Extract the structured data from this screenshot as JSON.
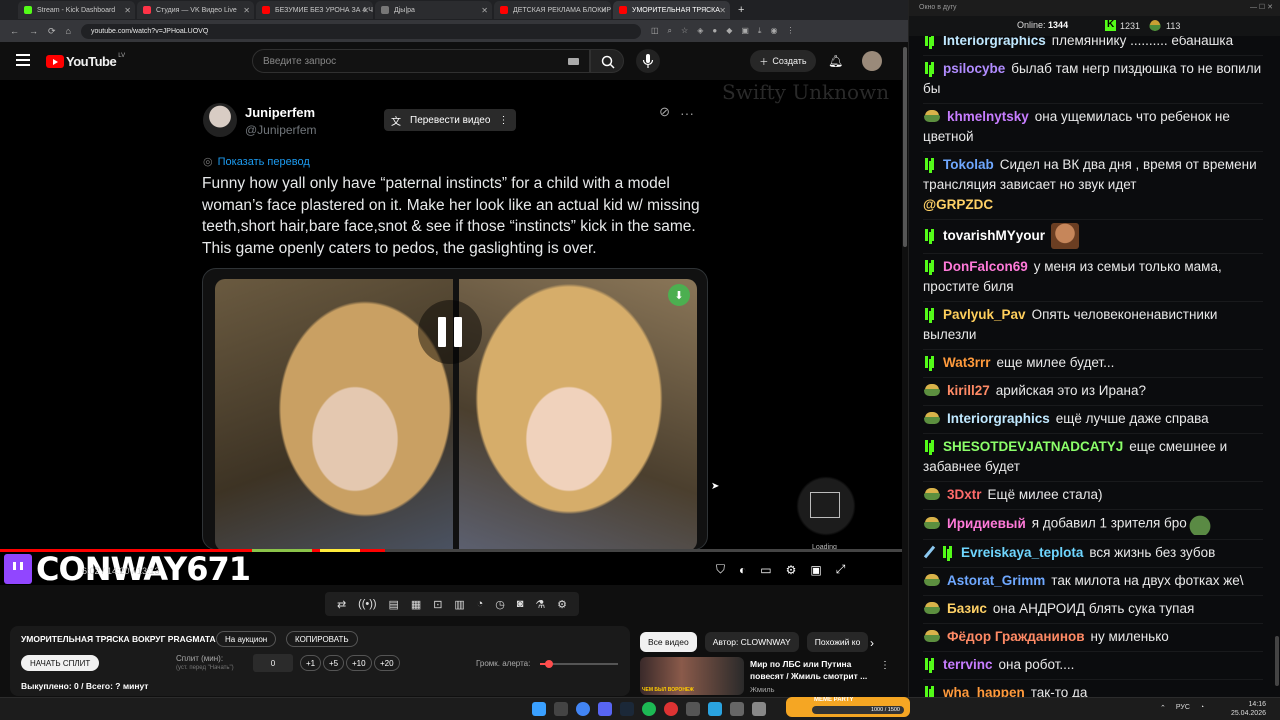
{
  "browser": {
    "tabs": [
      {
        "label": "Stream - Kick Dashboard",
        "color": "#53fc18"
      },
      {
        "label": "Студия — VK Видео Live",
        "color": "#ff3347"
      },
      {
        "label": "БЕЗУМИЕ БЕЗ УРОНА ЗА 4 ЧА",
        "color": "#ff0000"
      },
      {
        "label": "Дjы|ра",
        "color": "#777777"
      },
      {
        "label": "ДЕТСКАЯ РЕКЛАМА БЛОКИРО",
        "color": "#ff0000"
      },
      {
        "label": "УМОРИТЕЛЬНАЯ ТРЯСКА",
        "color": "#ff0000"
      }
    ],
    "url": "youtube.com/watch?v=JPHoaLUOVQ"
  },
  "youtube": {
    "region": "LV",
    "search_placeholder": "Введите запрос",
    "create_label": "Создать"
  },
  "tweet": {
    "name": "Juniperfem",
    "handle": "@Juniperfem",
    "translate_video": "Перевести видео",
    "show_translation": "Показать перевод",
    "text": "Funny how yall only have “paternal instincts” for a child with a model woman’s face plastered on it. Make her look like an actual kid w/ missing teeth,short hair,bare face,snot & see if those “instincts” kick in the same. This game openly caters to pedos, the gaslighting is over."
  },
  "watermark": "Swifty Unknown",
  "player": {
    "streamer": "CONWAY671",
    "time": "6:02 / 14:20 / 13:13",
    "loading": "Loading",
    "progress": 0.424
  },
  "panel": {
    "title": "УМОРИТЕЛЬНАЯ ТРЯСКА ВОКРУГ PRAGMATA",
    "auction": "На аукцион",
    "copy": "КОПИРОВАТЬ",
    "start_split": "НАЧАТЬ СПЛИТ",
    "split_label": "Сплит (мин):",
    "split_hint": "(уст. перед \"Начать\")",
    "split_value": "0",
    "inc": [
      "+1",
      "+5",
      "+10",
      "+20"
    ],
    "alert_volume": "Громк. алерта:",
    "alert_level": 0.12,
    "bought": "Выкуплено: 0 / Всего: ? минут"
  },
  "recs": {
    "chips": [
      "Все видео",
      "Автор: CLOWNWAY",
      "Похожий ко"
    ],
    "video_title": "Мир по ЛБС или Путина повесят / Жмиль смотрит ...",
    "video_author": "Жмиль",
    "thumb_text": "ЧЕМ БЫЛ ВОРОНЕЖ"
  },
  "chat": {
    "window_title": "Окно в дугу",
    "online_label": "Online:",
    "online": "1344",
    "kick_count": "1231",
    "sub_count": "113",
    "messages": [
      {
        "badge": "kick",
        "user": "Interiorgraphics",
        "color": "#c0e8ff",
        "text": "племяннику .......... ебанашка"
      },
      {
        "badge": "kick",
        "user": "psilocybe",
        "color": "#b18cff",
        "text": "былаб там негр пиздюшка то не вопили бы"
      },
      {
        "badge": "sub",
        "user": "khmelnytsky",
        "color": "#c77dff",
        "text": "она ущемилась что ребенок не цветной"
      },
      {
        "badge": "kick",
        "user": "Tokolab",
        "color": "#6fa8ff",
        "text": "Сидел на ВК два дня , время от времени трансляция зависает но звук идет",
        "mention": "@GRPZDC"
      },
      {
        "badge": "kick",
        "user": "tovarishMYyour",
        "color": "#ffffff",
        "text": "",
        "emote": "guy"
      },
      {
        "badge": "kick",
        "user": "DonFalcon69",
        "color": "#ff7ad9",
        "text": "у меня из семьи только мама, простите биля"
      },
      {
        "badge": "kick",
        "user": "Pavlyuk_Pav",
        "color": "#ffcf5c",
        "text": "Опять человеконенавистники вылезли"
      },
      {
        "badge": "kick",
        "user": "Wat3rrr",
        "color": "#ff9a3c",
        "text": "еще милее будет..."
      },
      {
        "badge": "sub",
        "user": "kirill27",
        "color": "#ff8a65",
        "text": "арийская это из Ирана?"
      },
      {
        "badge": "sub",
        "user": "Interiorgraphics",
        "color": "#c0e8ff",
        "text": "ещё лучше даже справа"
      },
      {
        "badge": "kick",
        "user": "SHESOTDEVJATNADCATYJ",
        "color": "#8cff6a",
        "text": "еще смешнее и забавнее будет"
      },
      {
        "badge": "sub",
        "user": "3Dxtr",
        "color": "#ff6b6b",
        "text": "Ещё милее стала)"
      },
      {
        "badge": "sub",
        "user": "Иридиевый",
        "color": "#ff7ad9",
        "text": "я добавил 1 зрителя бро",
        "emote": "pepe"
      },
      {
        "badge": "swordkick",
        "user": "Evreiskaya_teplota",
        "color": "#6fd6ff",
        "text": "вся жизнь без зубов"
      },
      {
        "badge": "sub",
        "user": "Astorat_Grimm",
        "color": "#6fa8ff",
        "text": "так милота на двух фотках же\\"
      },
      {
        "badge": "sub",
        "user": "Базис",
        "color": "#ffd166",
        "text": "она АНДРОИД блять сука тупая"
      },
      {
        "badge": "sub",
        "user": "Фёдор Гражданинов",
        "color": "#ff8a65",
        "text": "ну миленько"
      },
      {
        "badge": "kick",
        "user": "terrvinc",
        "color": "#c77dff",
        "text": "она робот...."
      },
      {
        "badge": "kick",
        "user": "wha_happen",
        "color": "#ff9a3c",
        "text": "так-то да"
      }
    ]
  },
  "taskbar": {
    "meme_label": "MEME PARTY",
    "meme_progress": "1000 / 1500",
    "lang": "РУС",
    "time": "14:16",
    "date": "25.04.2026"
  }
}
